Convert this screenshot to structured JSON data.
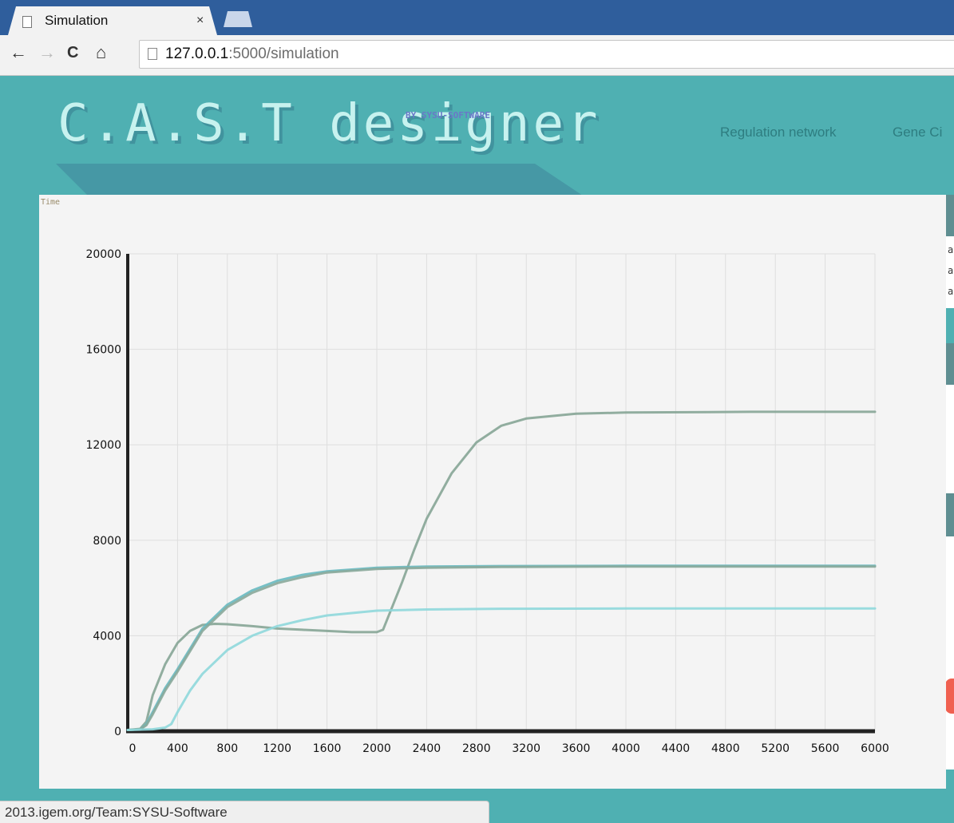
{
  "browser": {
    "tab_title": "Simulation",
    "tab_close": "×",
    "url_host": "127.0.0.1",
    "url_rest": ":5000/simulation",
    "back": "←",
    "forward": "→",
    "reload": "C",
    "home": "⌂",
    "status_url": "2013.igem.org/Team:SYSU-Software"
  },
  "header": {
    "logo": "C.A.S.T designer",
    "logo_sub": "BY SYSU-SOFTWARE",
    "nav": [
      "Regulation network",
      "Gene Ci"
    ]
  },
  "side_panel": {
    "chars": [
      "a",
      "a",
      "a"
    ],
    "accent": "#f06050"
  },
  "chart_data": {
    "type": "line",
    "title": "Time",
    "xlim": [
      0,
      6000
    ],
    "ylim": [
      0,
      20000
    ],
    "x_ticks": [
      0,
      400,
      800,
      1200,
      1600,
      2000,
      2400,
      2800,
      3200,
      3600,
      4000,
      4400,
      4800,
      5200,
      5600,
      6000
    ],
    "y_ticks": [
      0,
      4000,
      8000,
      12000,
      16000,
      20000
    ],
    "grid": true,
    "series": [
      {
        "color": "#86a596",
        "points": [
          [
            0,
            50
          ],
          [
            100,
            100
          ],
          [
            150,
            400
          ],
          [
            200,
            1500
          ],
          [
            300,
            2800
          ],
          [
            400,
            3700
          ],
          [
            500,
            4200
          ],
          [
            600,
            4450
          ],
          [
            700,
            4500
          ],
          [
            800,
            4480
          ],
          [
            1000,
            4400
          ],
          [
            1200,
            4300
          ],
          [
            1400,
            4250
          ],
          [
            1600,
            4200
          ],
          [
            1800,
            4150
          ],
          [
            2000,
            4150
          ],
          [
            2050,
            4250
          ],
          [
            2100,
            4900
          ],
          [
            2200,
            6200
          ],
          [
            2300,
            7600
          ],
          [
            2400,
            8900
          ],
          [
            2600,
            10800
          ],
          [
            2800,
            12100
          ],
          [
            3000,
            12800
          ],
          [
            3200,
            13100
          ],
          [
            3600,
            13300
          ],
          [
            4000,
            13350
          ],
          [
            5000,
            13380
          ],
          [
            6000,
            13380
          ]
        ]
      },
      {
        "color": "#68b9c0",
        "points": [
          [
            0,
            50
          ],
          [
            100,
            80
          ],
          [
            150,
            300
          ],
          [
            200,
            800
          ],
          [
            300,
            1800
          ],
          [
            400,
            2600
          ],
          [
            600,
            4300
          ],
          [
            800,
            5300
          ],
          [
            1000,
            5900
          ],
          [
            1200,
            6300
          ],
          [
            1400,
            6550
          ],
          [
            1600,
            6700
          ],
          [
            2000,
            6850
          ],
          [
            2400,
            6900
          ],
          [
            3000,
            6920
          ],
          [
            4000,
            6930
          ],
          [
            6000,
            6930
          ]
        ]
      },
      {
        "color": "#8aa89a",
        "points": [
          [
            0,
            50
          ],
          [
            100,
            80
          ],
          [
            150,
            250
          ],
          [
            200,
            700
          ],
          [
            300,
            1700
          ],
          [
            400,
            2500
          ],
          [
            600,
            4200
          ],
          [
            800,
            5200
          ],
          [
            1000,
            5800
          ],
          [
            1200,
            6200
          ],
          [
            1400,
            6450
          ],
          [
            1600,
            6650
          ],
          [
            2000,
            6800
          ],
          [
            2400,
            6850
          ],
          [
            3000,
            6880
          ],
          [
            4000,
            6900
          ],
          [
            6000,
            6900
          ]
        ]
      },
      {
        "color": "#8fd8dc",
        "points": [
          [
            0,
            50
          ],
          [
            200,
            80
          ],
          [
            300,
            150
          ],
          [
            350,
            300
          ],
          [
            400,
            800
          ],
          [
            500,
            1700
          ],
          [
            600,
            2400
          ],
          [
            800,
            3400
          ],
          [
            1000,
            4000
          ],
          [
            1200,
            4400
          ],
          [
            1400,
            4650
          ],
          [
            1600,
            4850
          ],
          [
            1800,
            4950
          ],
          [
            2000,
            5050
          ],
          [
            2400,
            5100
          ],
          [
            3000,
            5130
          ],
          [
            4000,
            5140
          ],
          [
            6000,
            5140
          ]
        ]
      }
    ]
  }
}
